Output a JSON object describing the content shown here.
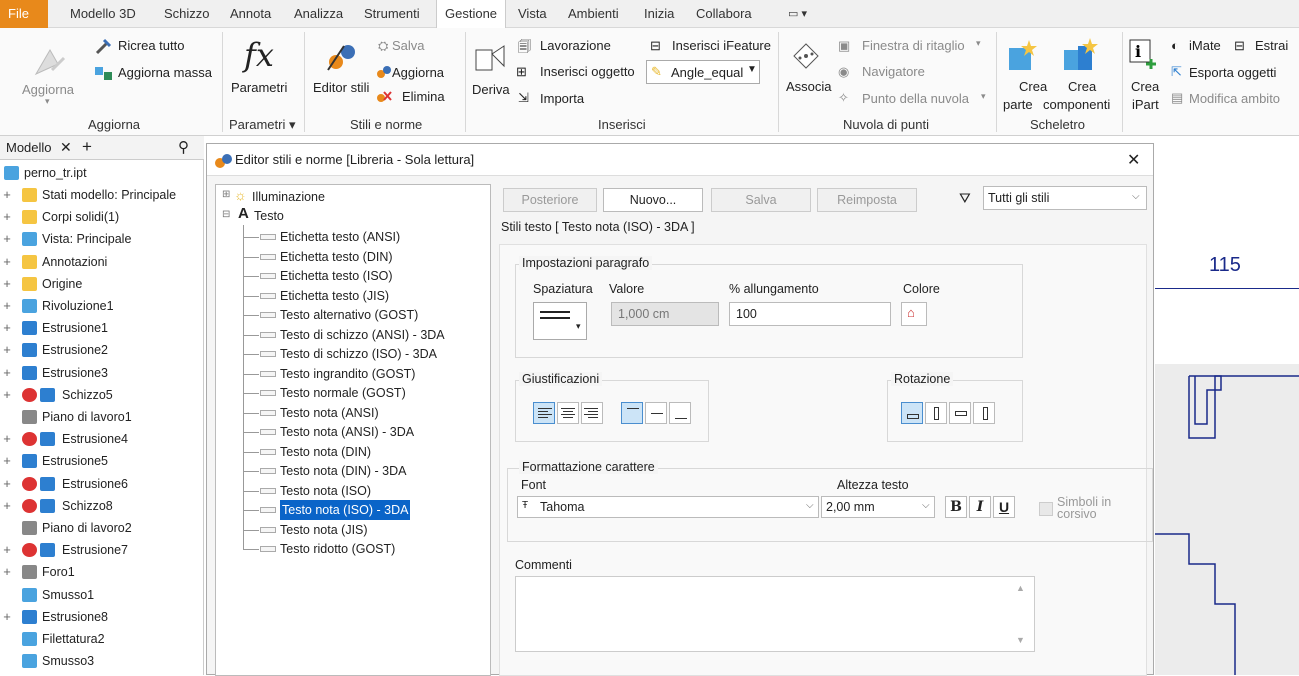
{
  "menubar": {
    "items": [
      "File",
      "Modello 3D",
      "Schizzo",
      "Annota",
      "Analizza",
      "Strumenti",
      "Gestione",
      "Vista",
      "Ambienti",
      "Inizia",
      "Collabora"
    ],
    "active": "Gestione",
    "extra_icon": "window-dropdown-icon"
  },
  "ribbon": {
    "aggiorna": {
      "big_label": "Aggiorna",
      "ricrea_tutto": "Ricrea tutto",
      "aggiorna_massa": "Aggiorna massa",
      "group": "Aggiorna"
    },
    "parametri": {
      "label": "Parametri",
      "group": "Parametri ▾"
    },
    "stili": {
      "editor": "Editor stili",
      "salva": "Salva",
      "aggiorna": "Aggiorna",
      "elimina": "Elimina",
      "group": "Stili e norme"
    },
    "inserisci": {
      "deriva": "Deriva",
      "lavorazione": "Lavorazione",
      "inserisci_oggetto": "Inserisci oggetto",
      "importa": "Importa",
      "ifeature": "Inserisci iFeature",
      "angle_equal": "Angle_equal",
      "group": "Inserisci"
    },
    "nuvola": {
      "associa": "Associa",
      "finestra": "Finestra di ritaglio",
      "navigatore": "Navigatore",
      "punto": "Punto della nuvola",
      "group": "Nuvola di punti"
    },
    "scheletro": {
      "crea_parte_1": "Crea",
      "crea_parte_2": "parte",
      "crea_comp_1": "Crea",
      "crea_comp_2": "componenti",
      "group": "Scheletro"
    },
    "ipart": {
      "crea_1": "Crea",
      "crea_2": "iPart",
      "imate": "iMate",
      "estrai": "Estrai",
      "esporta": "Esporta oggetti",
      "modifica": "Modifica ambito"
    }
  },
  "model_panel": {
    "tab": "Modello",
    "file": "perno_tr.ipt",
    "items": [
      {
        "label": "Stati modello: Principale",
        "icon": "folder-icon",
        "color": "#f5c542"
      },
      {
        "label": "Corpi solidi(1)",
        "icon": "solid-bodies-icon",
        "color": "#f5c542"
      },
      {
        "label": "Vista: Principale",
        "icon": "view-icon",
        "color": "#4aa3df"
      },
      {
        "label": "Annotazioni",
        "icon": "annotation-icon",
        "color": "#f5c542"
      },
      {
        "label": "Origine",
        "icon": "folder-icon",
        "color": "#f5c542"
      },
      {
        "label": "Rivoluzione1",
        "icon": "revolve-icon",
        "color": "#4aa3df"
      },
      {
        "label": "Estrusione1",
        "icon": "extrude-icon",
        "color": "#2d7fd0"
      },
      {
        "label": "Estrusione2",
        "icon": "extrude-icon",
        "color": "#2d7fd0"
      },
      {
        "label": "Estrusione3",
        "icon": "extrude-icon",
        "color": "#2d7fd0"
      },
      {
        "label": "Schizzo5",
        "icon": "sketch-icon",
        "color": "#d33"
      },
      {
        "label": "Piano di lavoro1",
        "icon": "workplane-icon",
        "color": "#888"
      },
      {
        "label": "Estrusione4",
        "icon": "extrude-icon",
        "color": "#d33"
      },
      {
        "label": "Estrusione5",
        "icon": "extrude-icon",
        "color": "#2d7fd0"
      },
      {
        "label": "Estrusione6",
        "icon": "extrude-icon",
        "color": "#d33"
      },
      {
        "label": "Schizzo8",
        "icon": "sketch-icon",
        "color": "#d33"
      },
      {
        "label": "Piano di lavoro2",
        "icon": "workplane-icon",
        "color": "#888"
      },
      {
        "label": "Estrusione7",
        "icon": "extrude-icon",
        "color": "#d33"
      },
      {
        "label": "Foro1",
        "icon": "hole-icon",
        "color": "#888"
      },
      {
        "label": "Smusso1",
        "icon": "chamfer-icon",
        "color": "#4aa3df"
      },
      {
        "label": "Estrusione8",
        "icon": "extrude-icon",
        "color": "#2d7fd0"
      },
      {
        "label": "Filettatura2",
        "icon": "thread-icon",
        "color": "#4aa3df"
      },
      {
        "label": "Smusso3",
        "icon": "chamfer-icon",
        "color": "#4aa3df"
      }
    ]
  },
  "dialog": {
    "title": "Editor stili e norme [Libreria - Sola lettura]",
    "tree": {
      "root1": "Illuminazione",
      "root2": "Testo",
      "children": [
        "Etichetta testo (ANSI)",
        "Etichetta testo (DIN)",
        "Etichetta testo (ISO)",
        "Etichetta testo (JIS)",
        "Testo alternativo (GOST)",
        "Testo di schizzo (ANSI) - 3DA",
        "Testo di schizzo (ISO) - 3DA",
        "Testo ingrandito (GOST)",
        "Testo normale (GOST)",
        "Testo nota (ANSI)",
        "Testo nota (ANSI) - 3DA",
        "Testo nota (DIN)",
        "Testo nota (DIN) - 3DA",
        "Testo nota (ISO)",
        "Testo nota (ISO) - 3DA",
        "Testo nota (JIS)",
        "Testo ridotto (GOST)"
      ],
      "selected": "Testo nota (ISO) - 3DA"
    },
    "buttons": {
      "posteriore": "Posteriore",
      "nuovo": "Nuovo...",
      "salva": "Salva",
      "reimposta": "Reimposta"
    },
    "filter": "Tutti gli stili",
    "header": "Stili testo [ Testo nota (ISO) - 3DA ]",
    "paragrafo": {
      "legend": "Impostazioni paragrafo",
      "spaziatura": "Spaziatura",
      "valore": "Valore",
      "valore_val": "1,000 cm",
      "allungamento": "% allungamento",
      "allungamento_val": "100",
      "colore": "Colore"
    },
    "giustificazioni": "Giustificazioni",
    "rotazione": "Rotazione",
    "carattere": {
      "legend": "Formattazione carattere",
      "font_label": "Font",
      "font_val": "Tahoma",
      "altezza_label": "Altezza testo",
      "altezza_val": "2,00 mm",
      "bold": "B",
      "italic": "I",
      "underline": "U",
      "simboli_1": "Simboli in",
      "simboli_2": "corsivo"
    },
    "commenti": "Commenti"
  },
  "drawing": {
    "dimension": "115"
  },
  "colors": {
    "accent": "#e8891b",
    "selection": "#0a64c8",
    "drawing_line": "#1a2a8a"
  }
}
